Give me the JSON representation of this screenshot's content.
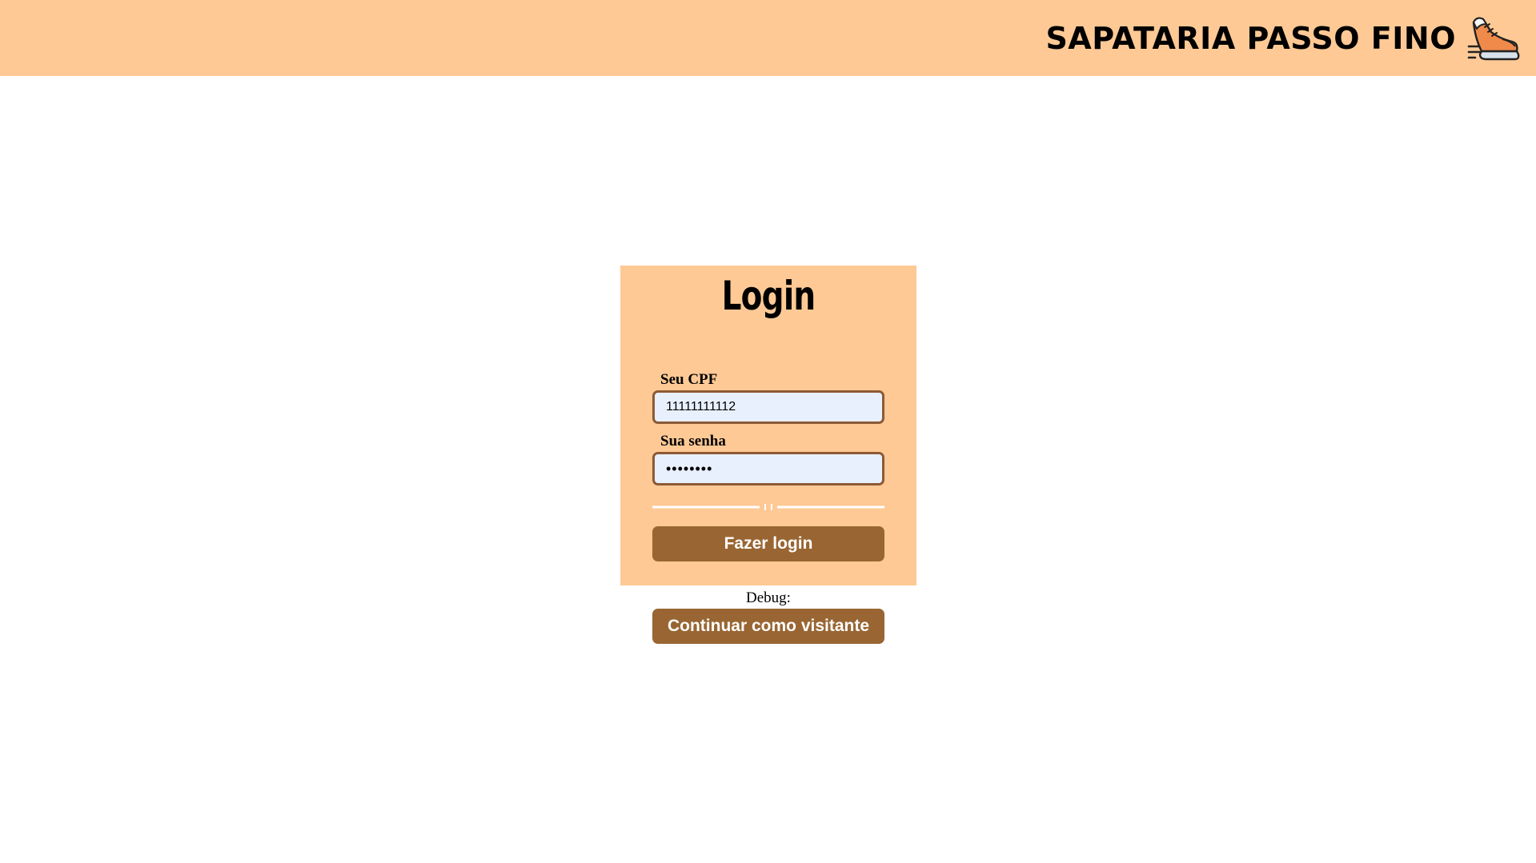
{
  "header": {
    "brand_name": "SAPATARIA PASSO FINO",
    "brand_icon": "running-shoe-icon",
    "background_color": "#FEC995"
  },
  "login": {
    "title": "Login",
    "cpf_label": "Seu CPF",
    "cpf_value": "11111111112",
    "password_label": "Sua senha",
    "password_value": "••••••••",
    "submit_label": "Fazer login",
    "divider_mark": "| |"
  },
  "debug": {
    "label": "Debug:",
    "visitor_button_label": "Continuar como visitante"
  },
  "colors": {
    "accent": "#FEC995",
    "button": "#996633",
    "input_border": "#8C5A35",
    "input_background": "#E8F0FE"
  }
}
